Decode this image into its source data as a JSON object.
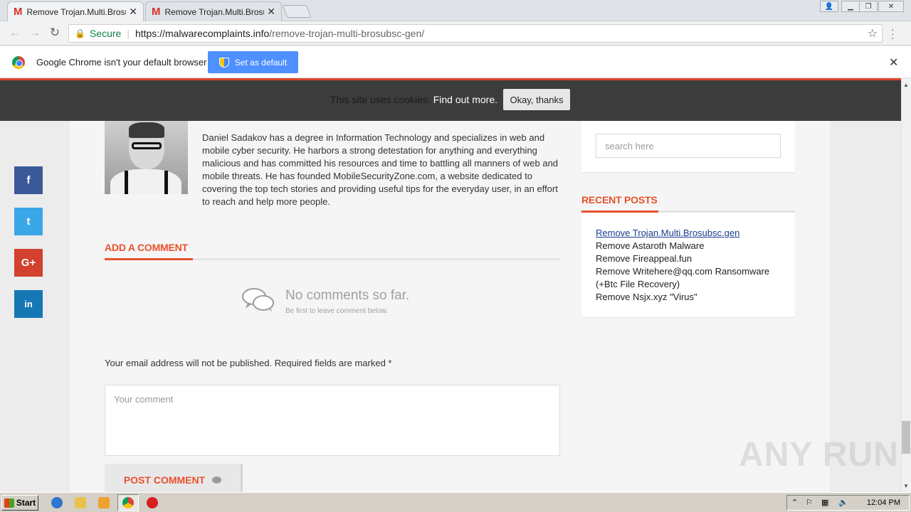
{
  "browser": {
    "tabs": [
      {
        "favicon": "M",
        "title": "Remove Trojan.Multi.Brosubsc",
        "active": true
      },
      {
        "favicon": "M",
        "title": "Remove Trojan.Multi.Brosubsc",
        "active": false
      }
    ],
    "url": {
      "security_label": "Secure",
      "host": "https://malwarecomplaints.info",
      "path": "/remove-trojan-multi-brosubsc-gen/"
    }
  },
  "infobar": {
    "message": "Google Chrome isn't your default browser",
    "button_label": "Set as default"
  },
  "cookie_bar": {
    "text": "This site uses cookies.",
    "link": "Find out more.",
    "button": "Okay, thanks"
  },
  "author": {
    "bio": "Daniel Sadakov has a degree in Information Technology and specializes in web and mobile cyber security. He harbors a strong detestation for anything and everything malicious and has committed his resources and time to battling all manners of web and mobile threats. He has founded MobileSecurityZone.com, a website dedicated to covering the top tech stories and providing useful tips for the everyday user, in an effort to reach and help more people."
  },
  "comments": {
    "section_title": "ADD A COMMENT",
    "empty_title": "No comments so far.",
    "empty_subtitle": "Be first to leave comment below.",
    "email_note": "Your email address will not be published. Required fields are marked *",
    "comment_placeholder": "Your comment",
    "post_button": "POST COMMENT"
  },
  "sidebar": {
    "search_placeholder": "search here",
    "recent_title": "RECENT POSTS",
    "recent_posts": [
      "Remove Trojan.Multi.Brosubsc.gen",
      "Remove Astaroth Malware",
      "Remove Fireappeal.fun",
      "Remove Writehere@qq.com Ransomware (+Btc File Recovery)",
      "Remove Nsjx.xyz \"Virus\""
    ]
  },
  "share": {
    "facebook": "f",
    "twitter": "t",
    "googleplus": "G+",
    "linkedin": "in"
  },
  "watermark": "ANY RUN",
  "taskbar": {
    "start_label": "Start",
    "clock": "12:04 PM"
  },
  "colors": {
    "accent": "#e8512c",
    "facebook": "#3b5998",
    "twitter": "#3aa7e8",
    "googleplus": "#d2402e",
    "linkedin": "#1677b4",
    "chrome_button": "#4d90fe"
  }
}
